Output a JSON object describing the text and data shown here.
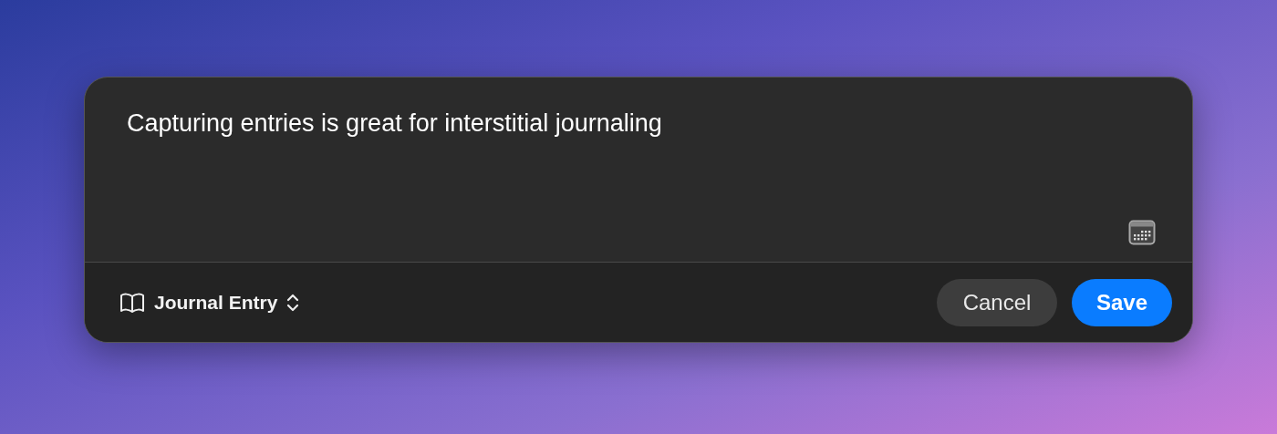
{
  "entry": {
    "value": "Capturing entries is great for interstitial journaling"
  },
  "entry_type": {
    "label": "Journal Entry"
  },
  "buttons": [
    {
      "label": "Cancel",
      "kind": "secondary"
    },
    {
      "label": "Save",
      "kind": "primary"
    }
  ]
}
